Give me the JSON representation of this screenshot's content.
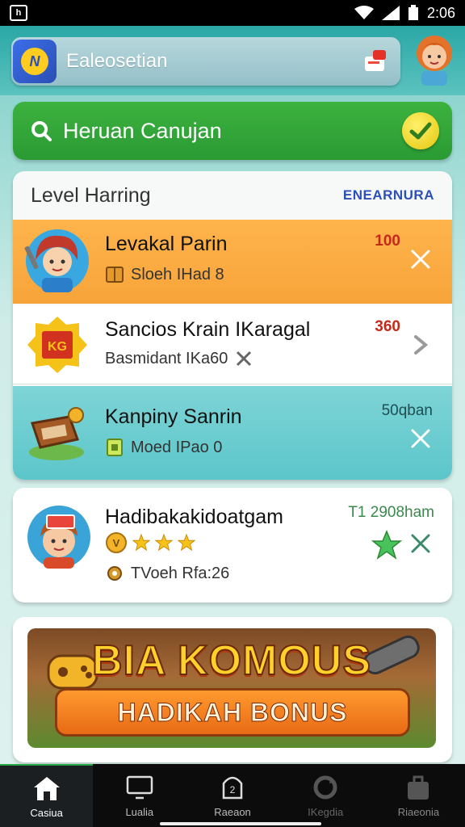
{
  "status_bar": {
    "time": "2:06"
  },
  "app_bar": {
    "title": "Ealeosetian"
  },
  "banner": {
    "text": "Heruan Canujan"
  },
  "level_card": {
    "title": "Level Harring",
    "link": "ENEARNURA",
    "rows": [
      {
        "title": "Levakal Parin",
        "subtitle": "Sloeh IHad 8",
        "value": "100"
      },
      {
        "title": "Sancios Krain IKaragal",
        "subtitle": "Basmidant IKa60",
        "value": "360"
      },
      {
        "title": "Kanpiny Sanrin",
        "subtitle": "Moed IPao 0",
        "value": "50qban"
      }
    ]
  },
  "achievement": {
    "title": "Hadibakakidoatgam",
    "value": "T1 2908ham",
    "subtitle": "TVoeh Rfa:26",
    "stars": 3
  },
  "bonus": {
    "title": "BIA KOMOUS",
    "button": "HADIKAH BONUS"
  },
  "bottom_nav": [
    {
      "label": "Casiua",
      "icon": "home-icon",
      "active": true
    },
    {
      "label": "Lualia",
      "icon": "monitor-icon",
      "active": false
    },
    {
      "label": "Raeaon",
      "icon": "profile-icon",
      "active": false
    },
    {
      "label": "IKegdia",
      "icon": "refresh-icon",
      "active": false
    },
    {
      "label": "Riaeonia",
      "icon": "bag-icon",
      "active": false
    }
  ],
  "colors": {
    "accent_teal": "#3fb7b4",
    "banner_green": "#2a9a33",
    "row_orange": "#f7a43a",
    "row_teal": "#5cc6ca",
    "value_red": "#c32a1a",
    "link_blue": "#2c4fb8"
  }
}
